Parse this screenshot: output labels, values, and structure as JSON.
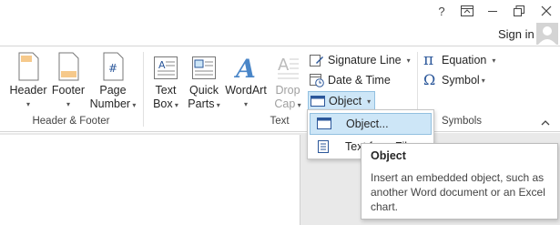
{
  "titlebar": {
    "help": "?",
    "ribbon_display": "ribbon-display-options-icon",
    "minimize": "minimize-icon",
    "restore": "restore-icon",
    "close": "close-icon"
  },
  "account": {
    "sign_in": "Sign in"
  },
  "ribbon": {
    "header_footer": {
      "group_label": "Header & Footer",
      "header": [
        "Header"
      ],
      "footer": [
        "Footer"
      ],
      "page_number": [
        "Page",
        "Number"
      ]
    },
    "text": {
      "group_label": "Text",
      "text_box": [
        "Text",
        "Box"
      ],
      "quick_parts": [
        "Quick",
        "Parts"
      ],
      "wordart": [
        "WordArt"
      ],
      "drop_cap": [
        "Drop",
        "Cap"
      ],
      "signature_line": "Signature Line",
      "date_time": "Date & Time",
      "object": "Object"
    },
    "symbols": {
      "group_label": "Symbols",
      "equation": "Equation",
      "symbol": "Symbol"
    }
  },
  "object_menu": {
    "items": [
      {
        "label": "Object..."
      },
      {
        "label": "Text from File..."
      }
    ]
  },
  "tooltip": {
    "title": "Object",
    "description": "Insert an embedded object, such as another Word document or an Excel chart."
  },
  "colors": {
    "accent": "#2b579a",
    "highlight": "#cde6f7",
    "highlight_border": "#92c0e0"
  }
}
